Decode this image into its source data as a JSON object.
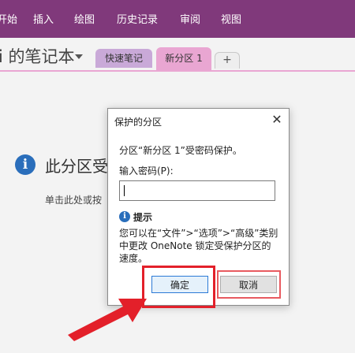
{
  "ribbon": {
    "items": [
      "开始",
      "插入",
      "绘图",
      "历史记录",
      "审阅",
      "视图"
    ]
  },
  "notebook": {
    "title": "i 的笔记本",
    "tabs": [
      {
        "label": "快速笔记"
      },
      {
        "label": "新分区 1"
      },
      {
        "label": "+"
      }
    ]
  },
  "content": {
    "locked_title": "此分区受",
    "locked_hint": "单击此处或按"
  },
  "dialog": {
    "title": "保护的分区",
    "close": "✕",
    "message": "分区“新分区 1”受密码保护。",
    "password_label": "输入密码(P):",
    "password_value": "",
    "tip_heading": "提示",
    "tip_lines": [
      "您可以在“文件”>“选项”>“高级”类别",
      "中更改 OneNote 锁定受保护分区的",
      "速度。"
    ],
    "ok_label": "确定",
    "cancel_label": "取消"
  },
  "colors": {
    "ribbon": "#80397b",
    "section_tab": "#e9a6d2",
    "quick_tab": "#c9a9d8",
    "highlight": "#e3202a",
    "info": "#2a6ebb"
  },
  "icons": [
    "dropdown-caret-icon",
    "info-icon",
    "close-icon",
    "tip-info-icon",
    "pointer-arrow-icon"
  ]
}
